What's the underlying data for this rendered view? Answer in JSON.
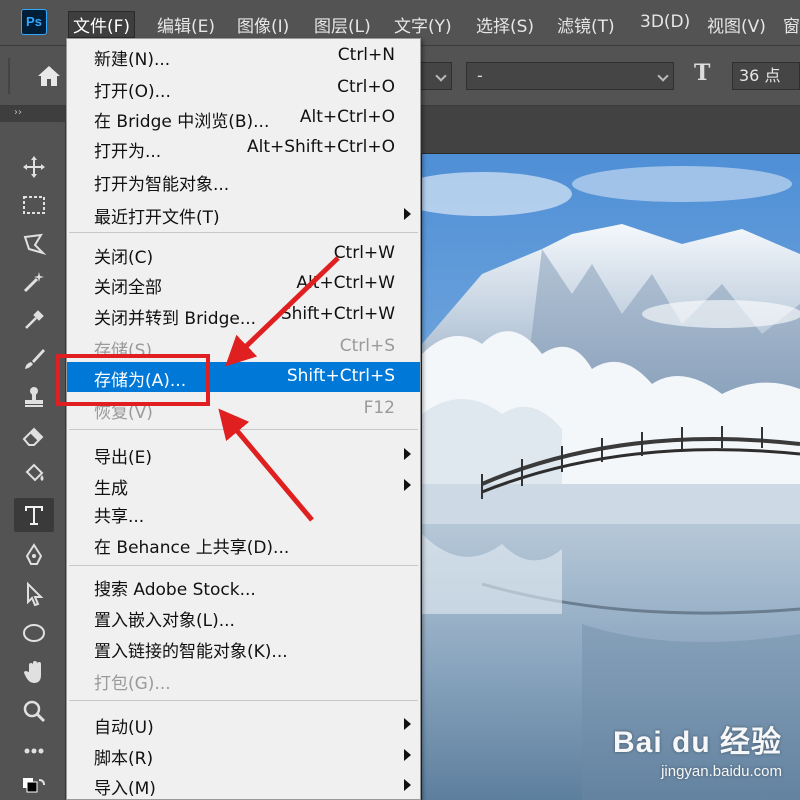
{
  "app": {
    "logo_text": "Ps"
  },
  "menubar": {
    "items": [
      {
        "label": "文件(F)"
      },
      {
        "label": "编辑(E)"
      },
      {
        "label": "图像(I)"
      },
      {
        "label": "图层(L)"
      },
      {
        "label": "文字(Y)"
      },
      {
        "label": "选择(S)"
      },
      {
        "label": "滤镜(T)"
      },
      {
        "label": "3D(D)"
      },
      {
        "label": "视图(V)"
      },
      {
        "label": "窗"
      }
    ]
  },
  "options_bar": {
    "font_style_value": "-",
    "font_size_value": "36 点",
    "font_size_icon_text": "T"
  },
  "tool_panel": {
    "collapse_label": "››"
  },
  "file_menu": {
    "groups": [
      [
        {
          "label": "新建(N)...",
          "shortcut": "Ctrl+N"
        },
        {
          "label": "打开(O)...",
          "shortcut": "Ctrl+O"
        },
        {
          "label": "在 Bridge 中浏览(B)...",
          "shortcut": "Alt+Ctrl+O"
        },
        {
          "label": "打开为...",
          "shortcut": "Alt+Shift+Ctrl+O"
        },
        {
          "label": "打开为智能对象...",
          "shortcut": ""
        },
        {
          "label": "最近打开文件(T)",
          "shortcut": "",
          "submenu": true
        }
      ],
      [
        {
          "label": "关闭(C)",
          "shortcut": "Ctrl+W"
        },
        {
          "label": "关闭全部",
          "shortcut": "Alt+Ctrl+W"
        },
        {
          "label": "关闭并转到 Bridge...",
          "shortcut": "Shift+Ctrl+W"
        },
        {
          "label": "存储(S)",
          "shortcut": "Ctrl+S",
          "disabled": true
        },
        {
          "label": "存储为(A)...",
          "shortcut": "Shift+Ctrl+S",
          "highlighted": true
        },
        {
          "label": "恢复(V)",
          "shortcut": "F12",
          "disabled": true
        }
      ],
      [
        {
          "label": "导出(E)",
          "shortcut": "",
          "submenu": true
        },
        {
          "label": "生成",
          "shortcut": "",
          "submenu": true
        },
        {
          "label": "共享...",
          "shortcut": ""
        },
        {
          "label": "在 Behance 上共享(D)...",
          "shortcut": ""
        }
      ],
      [
        {
          "label": "搜索 Adobe Stock...",
          "shortcut": ""
        },
        {
          "label": "置入嵌入对象(L)...",
          "shortcut": ""
        },
        {
          "label": "置入链接的智能对象(K)...",
          "shortcut": ""
        },
        {
          "label": "打包(G)...",
          "shortcut": "",
          "disabled": true
        }
      ],
      [
        {
          "label": "自动(U)",
          "shortcut": "",
          "submenu": true
        },
        {
          "label": "脚本(R)",
          "shortcut": "",
          "submenu": true
        },
        {
          "label": "导入(M)",
          "shortcut": "",
          "submenu": true
        }
      ]
    ]
  },
  "watermark": {
    "brand": "Bai du 经验",
    "url": "jingyan.baidu.com"
  },
  "colors": {
    "highlight": "#0078d7",
    "annotation": "#e02020",
    "ps_accent": "#31a8ff"
  }
}
